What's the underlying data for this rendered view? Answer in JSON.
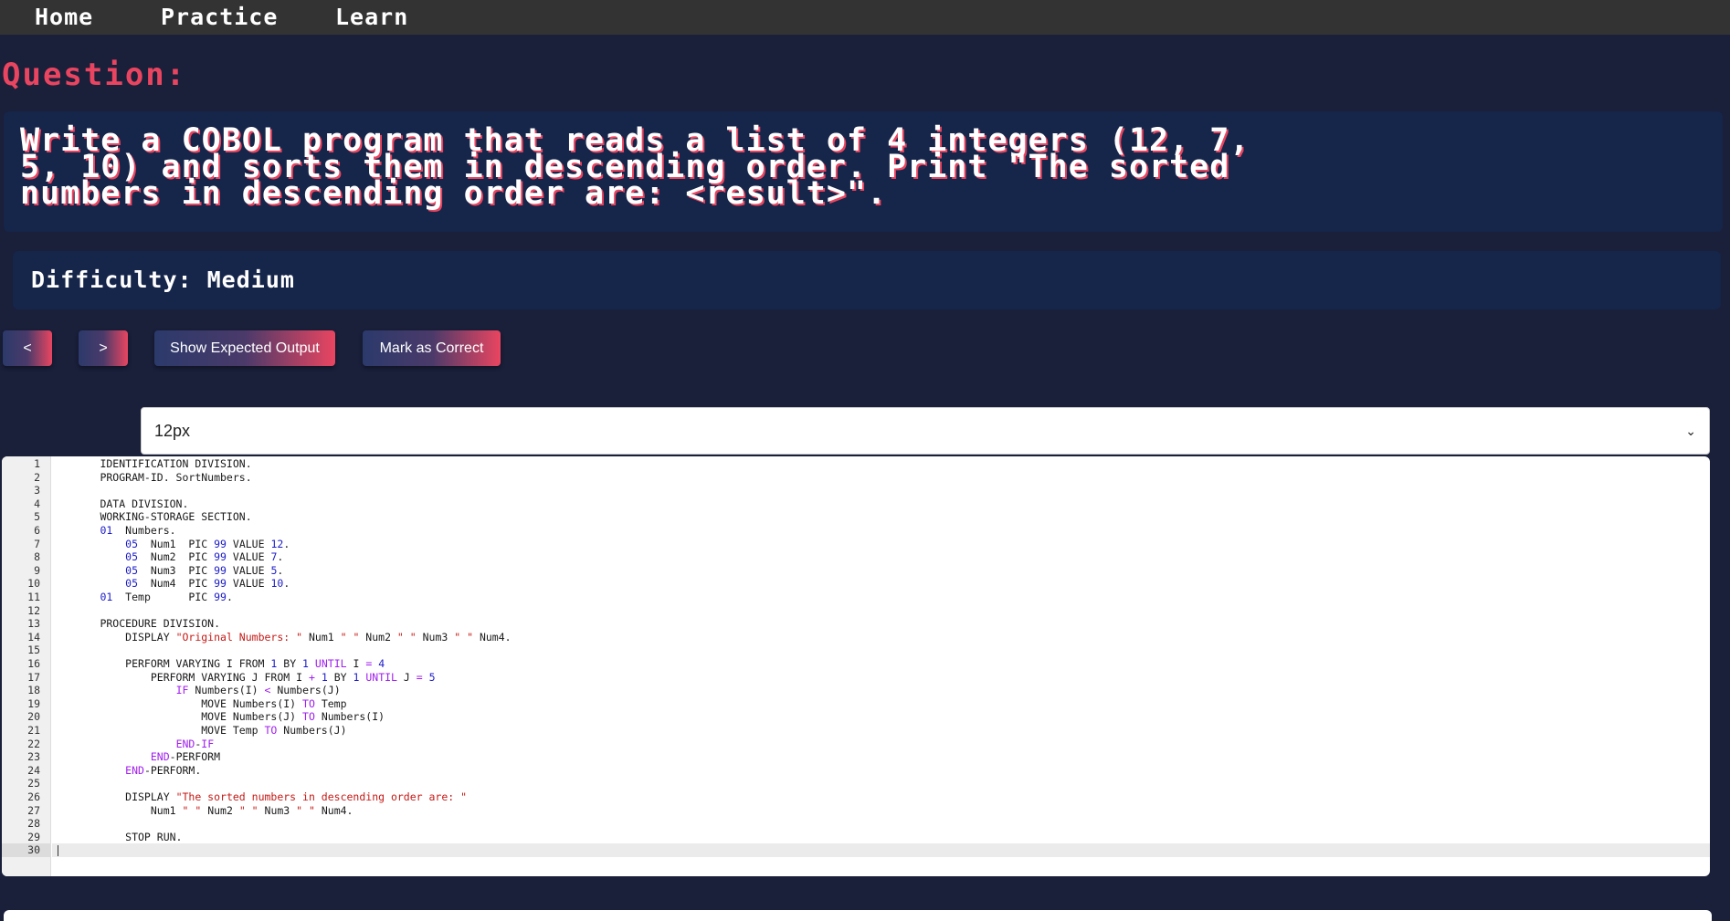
{
  "nav": {
    "home": "Home",
    "practice": "Practice",
    "learn": "Learn"
  },
  "question": {
    "heading": "Question:",
    "lines": [
      "Write a COBOL program that reads a list of 4 integers (12, 7,",
      "5, 10) and sorts them in descending order. Print \"The sorted",
      "numbers in descending order are: <result>\"."
    ]
  },
  "difficulty": {
    "label": "Difficulty: Medium"
  },
  "controls": {
    "prev_label": "<",
    "next_label": ">",
    "show_output_label": "Show Expected Output",
    "mark_correct_label": "Mark as Correct"
  },
  "font_size_select": {
    "selected": "12px"
  },
  "editor": {
    "active_line": 30,
    "lines": [
      "       IDENTIFICATION DIVISION.",
      "       PROGRAM-ID. SortNumbers.",
      "",
      "       DATA DIVISION.",
      "       WORKING-STORAGE SECTION.",
      "       01  Numbers.",
      "           05  Num1  PIC 99 VALUE 12.",
      "           05  Num2  PIC 99 VALUE 7.",
      "           05  Num3  PIC 99 VALUE 5.",
      "           05  Num4  PIC 99 VALUE 10.",
      "       01  Temp      PIC 99.",
      "",
      "       PROCEDURE DIVISION.",
      "           DISPLAY \"Original Numbers: \" Num1 \" \" Num2 \" \" Num3 \" \" Num4.",
      "",
      "           PERFORM VARYING I FROM 1 BY 1 UNTIL I = 4",
      "               PERFORM VARYING J FROM I + 1 BY 1 UNTIL J = 5",
      "                   IF Numbers(I) < Numbers(J)",
      "                       MOVE Numbers(I) TO Temp",
      "                       MOVE Numbers(J) TO Numbers(I)",
      "                       MOVE Temp TO Numbers(J)",
      "                   END-IF",
      "               END-PERFORM",
      "           END-PERFORM.",
      "",
      "           DISPLAY \"The sorted numbers in descending order are: \"",
      "               Num1 \" \" Num2 \" \" Num3 \" \" Num4.",
      "",
      "           STOP RUN.",
      ""
    ]
  },
  "colors": {
    "background": "#1a1f3a",
    "nav": "#333333",
    "accent": "#e94560",
    "panel": "#16254a"
  }
}
